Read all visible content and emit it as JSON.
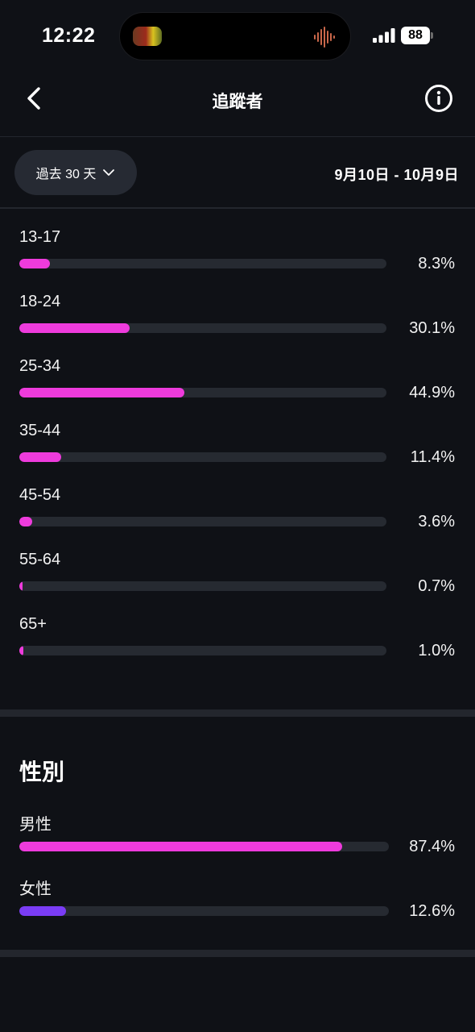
{
  "status_bar": {
    "time": "12:22",
    "battery": "88"
  },
  "header": {
    "title": "追蹤者",
    "back_icon": "chevron-left-icon",
    "info_icon": "info-circle-icon"
  },
  "filter": {
    "period_label": "過去 30 天",
    "date_range": "9月10日 - 10月9日"
  },
  "age_groups": [
    {
      "label": "13-17",
      "value": "8.3%",
      "fraction": 0.083
    },
    {
      "label": "18-24",
      "value": "30.1%",
      "fraction": 0.301
    },
    {
      "label": "25-34",
      "value": "44.9%",
      "fraction": 0.449
    },
    {
      "label": "35-44",
      "value": "11.4%",
      "fraction": 0.114
    },
    {
      "label": "45-54",
      "value": "3.6%",
      "fraction": 0.036
    },
    {
      "label": "55-64",
      "value": "0.7%",
      "fraction": 0.007
    },
    {
      "label": "65+",
      "value": "1.0%",
      "fraction": 0.01
    }
  ],
  "gender": {
    "title": "性別",
    "items": [
      {
        "label": "男性",
        "value": "87.4%",
        "fraction": 0.874,
        "color": "#ee3bdc"
      },
      {
        "label": "女性",
        "value": "12.6%",
        "fraction": 0.126,
        "color": "#7a3cf5"
      }
    ]
  },
  "colors": {
    "accent_pink": "#ee3bdc",
    "accent_purple": "#7a3cf5",
    "background": "#0f1116"
  }
}
